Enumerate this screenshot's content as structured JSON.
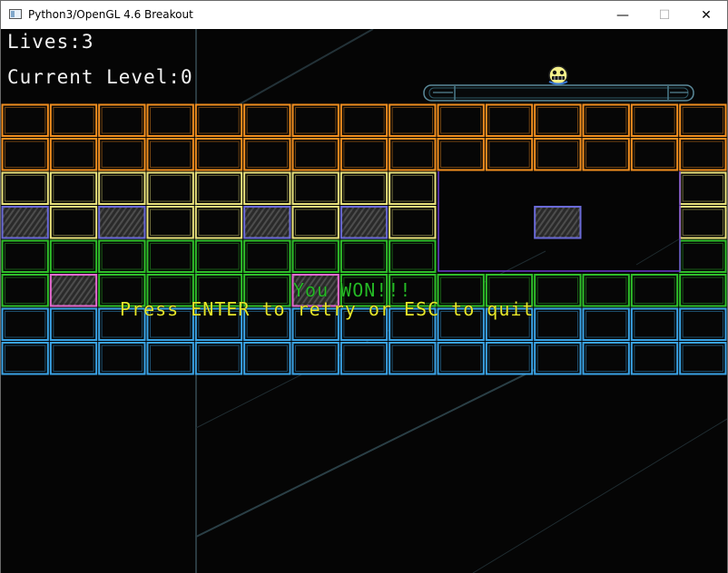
{
  "window": {
    "title": "Python3/OpenGL 4.6 Breakout",
    "buttons": {
      "minimize": "—",
      "maximize": "☐",
      "close": "✕"
    }
  },
  "hud": {
    "lives_label": "Lives:",
    "lives": 3,
    "level_label": "Current Level:",
    "level": 0
  },
  "messages": {
    "win": "You WON!!!",
    "prompt": "Press ENTER to retry or ESC to quit"
  },
  "colors": {
    "orange": "#f18e1f",
    "yellow": "#e9e27c",
    "green": "#2fbf2a",
    "blue": "#3aa3e6",
    "pink": "#e56ad0",
    "solid_edge": "#f2f2f2",
    "win_text": "#25b925",
    "prompt_text": "#e6e62a"
  },
  "bricks": {
    "columns": 15,
    "rows": [
      [
        "orange",
        "orange",
        "orange",
        "orange",
        "orange",
        "orange",
        "orange",
        "orange",
        "orange",
        "orange",
        "orange",
        "orange",
        "orange",
        "orange",
        "orange"
      ],
      [
        "orange",
        "orange",
        "orange",
        "orange",
        "orange",
        "orange",
        "orange",
        "orange",
        "orange",
        "orange",
        "orange",
        "orange",
        "orange",
        "orange",
        "orange"
      ],
      [
        "yellow",
        "yellow",
        "yellow",
        "yellow",
        "yellow",
        "yellow",
        "yellow",
        "yellow",
        "yellow",
        null,
        null,
        null,
        null,
        null,
        "yellow"
      ],
      [
        "solid",
        "yellow",
        "solid",
        "yellow",
        "yellow",
        "solid",
        "yellow",
        "solid",
        "yellow",
        null,
        null,
        "solid",
        null,
        null,
        "yellow"
      ],
      [
        "green",
        "green",
        "green",
        "green",
        "green",
        "green",
        "green",
        "green",
        "green",
        null,
        null,
        null,
        null,
        null,
        "green"
      ],
      [
        "green",
        "solid",
        "green",
        "green",
        "green",
        "green",
        "solid",
        "green",
        "green",
        "green",
        "green",
        "green",
        "green",
        "green",
        "green"
      ],
      [
        "blue",
        "blue",
        "blue",
        "blue",
        "blue",
        "blue",
        "blue",
        "blue",
        "blue",
        "blue",
        "blue",
        "blue",
        "blue",
        "blue",
        "blue"
      ],
      [
        "blue",
        "blue",
        "blue",
        "blue",
        "blue",
        "blue",
        "blue",
        "blue",
        "blue",
        "blue",
        "blue",
        "blue",
        "blue",
        "blue",
        "blue"
      ]
    ]
  },
  "ball": {
    "icon": "smiley-face-icon"
  },
  "paddle": {
    "icon": "paddle"
  }
}
